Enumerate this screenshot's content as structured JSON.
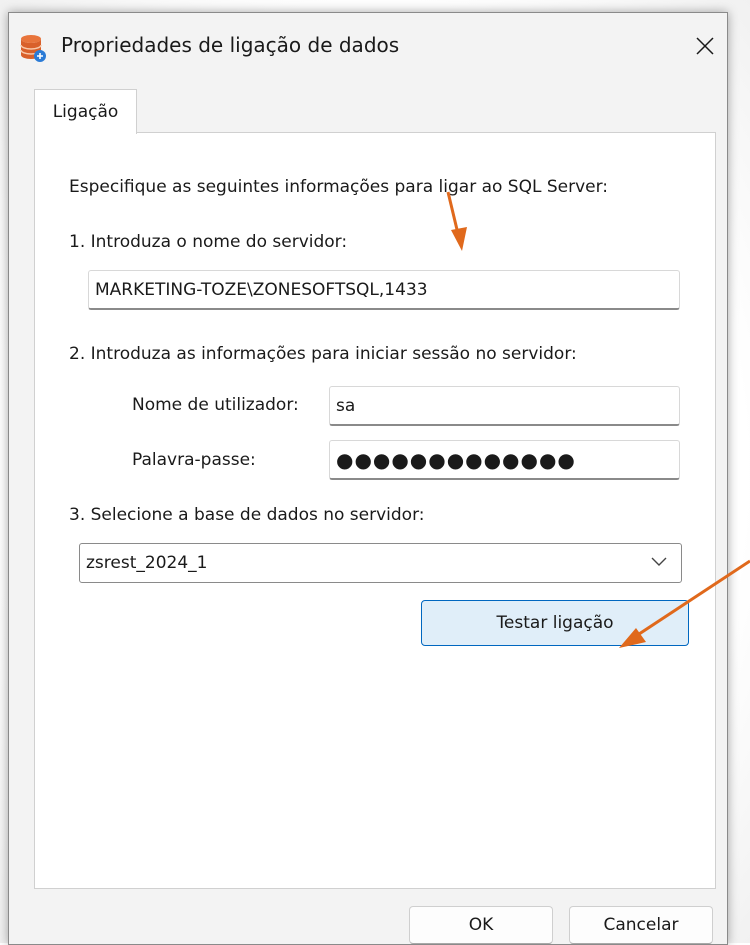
{
  "window": {
    "title": "Propriedades de ligação de dados",
    "app_icon": "database-icon",
    "close_icon": "close-icon"
  },
  "tabs": [
    {
      "label": "Ligação",
      "active": true
    }
  ],
  "form": {
    "intro": "Especifique as seguintes informações para ligar ao SQL Server:",
    "step1_label": "1. Introduza o nome do servidor:",
    "server_name": "MARKETING-TOZE\\ZONESOFTSQL,1433",
    "step2_label": "2. Introduza as informações para iniciar sessão no servidor:",
    "username_label": "Nome de utilizador:",
    "username": "sa",
    "password_label": "Palavra-passe:",
    "password_masked": "●●●●●●●●●●●●●",
    "step3_label": "3. Selecione a base de dados no servidor:",
    "database": "zsrest_2024_1",
    "test_button": "Testar ligação"
  },
  "footer": {
    "ok_label": "OK",
    "cancel_label": "Cancelar"
  },
  "annotations": {
    "arrow_color": "#e0691c"
  },
  "colors": {
    "accent": "#0067c0",
    "test_button_bg": "#e0eef9",
    "window_bg": "#f3f3f3"
  }
}
